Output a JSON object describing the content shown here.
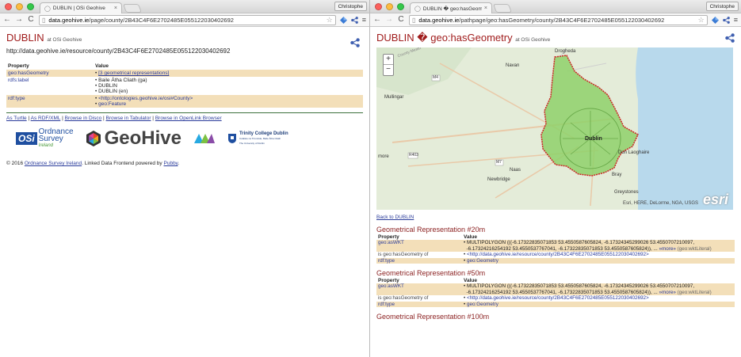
{
  "left": {
    "tab_title": "DUBLIN | OSi Geohive",
    "user_label": "Christophe",
    "url_domain": "data.geohive.ie",
    "url_path": "/page/county/2B43C4F6E2702485E055122030402692",
    "title": "DUBLIN",
    "title_at": "at OSi Geohive",
    "resource_uri": "http://data.geohive.ie/resource/county/2B43C4F6E2702485E055122030402692",
    "table": {
      "col_property": "Property",
      "col_value": "Value",
      "rows": [
        {
          "prop": "geo:hasGeometry",
          "values": [
            "[3 geometrical representations]"
          ]
        },
        {
          "prop": "rdfs:label",
          "values": [
            "Baile Átha Cliath (ga)",
            "DUBLIN",
            "DUBLIN (en)"
          ]
        },
        {
          "prop": "rdf:type",
          "values": [
            "<http://ontologies.geohive.ie/osi#County>",
            "geo:Feature"
          ]
        }
      ]
    },
    "links": [
      "As Turtle",
      "As RDF/XML",
      "Browse in Disco",
      "Browse in Tabulator",
      "Browse in OpenLink Browser"
    ],
    "logos": {
      "osi_abbr": "OSi",
      "osi_line1": "Ordnance",
      "osi_line2": "Survey",
      "osi_line3": "Ireland",
      "geohive": "GeoHive",
      "tcd_line1": "Trinity College Dublin",
      "tcd_line2": "Coláiste na Tríonóide, Baile Átha Cliath",
      "tcd_line3": "The University of Dublin"
    },
    "footer_prefix": "© 2016",
    "footer_link1": "Ordnance Survey Ireland",
    "footer_mid": ". Linked Data Frontend powered by",
    "footer_link2": "Pubby",
    "footer_end": "."
  },
  "right": {
    "tab_title": "DUBLIN � geo:hasGeometr",
    "user_label": "Christophe",
    "url_domain": "data.geohive.ie",
    "url_path": "/pathpage/geo:hasGeometry/county/2B43C4F6E2702485E055122030402692",
    "title": "DUBLIN � geo:hasGeometry",
    "title_at": "at OSi Geohive",
    "map": {
      "zoom_in": "+",
      "zoom_out": "−",
      "labels": {
        "drogheda": "Drogheda",
        "navan": "Navan",
        "mullingar": "Mullingar",
        "naas": "Naas",
        "dublin": "Dublin",
        "dun_laoghaire": "Dun Laoghaire",
        "bray": "Bray",
        "greystones": "Greystones",
        "newbridge": "Newbridge",
        "more": "more",
        "county": "County Meath",
        "r403": "R403",
        "m4": "M4",
        "m7": "M7"
      },
      "attribution": "Esri, HERE, DeLorme, NGA, USGS",
      "esri": "esri"
    },
    "back_link": "Back to DUBLIN",
    "sections": [
      {
        "title": "Geometrical Representation #20m",
        "col_property": "Property",
        "col_value": "Value",
        "wkt_prop": "geo:asWKT",
        "wkt_line1": "MULTIPOLYGON (((-6.17322835071853 53.4550587605824, -6.17324345299026 53.4550707210097,",
        "wkt_line2": "-6.17324216254192 53.4550537767041, -6.17322835071853 53.4550587605824)), ...",
        "more": "»more»",
        "literal": "(geo:wktLiteral)",
        "inv_prop": "is geo:hasGeometry of",
        "inv_value": "<http://data.geohive.ie/resource/county/2B43C4F6E2702485E055122030402692>",
        "type_prop": "rdf:type",
        "type_value": "geo:Geometry"
      },
      {
        "title": "Geometrical Representation #50m",
        "col_property": "Property",
        "col_value": "Value",
        "wkt_prop": "geo:asWKT",
        "wkt_line1": "MULTIPOLYGON (((-6.17322835071853 53.4550587605824, -6.17324345299026 53.4550707210097,",
        "wkt_line2": "-6.17324216254192 53.4550537767041, -6.17322835071853 53.4550587605824)), ...",
        "more": "»more»",
        "literal": "(geo:wktLiteral)",
        "inv_prop": "is geo:hasGeometry of",
        "inv_value": "<http://data.geohive.ie/resource/county/2B43C4F6E2702485E055122030402692>",
        "type_prop": "rdf:type",
        "type_value": "geo:Geometry"
      }
    ],
    "next_section_title": "Geometrical Representation #100m"
  },
  "colors": {
    "title_red": "#a01c1c",
    "row_highlight": "#f3dfb9",
    "link_blue": "#2b3c9b",
    "dublin_fill": "#8fd16a",
    "dublin_border": "#cc2222"
  }
}
